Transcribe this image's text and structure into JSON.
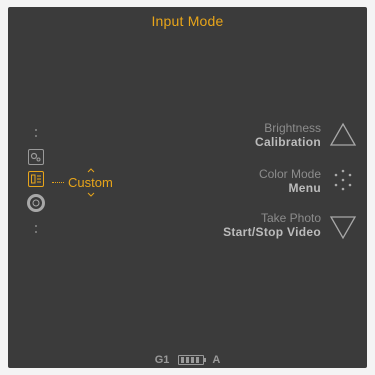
{
  "screen": {
    "title": "Input Mode"
  },
  "mode_selector": {
    "icons": [
      "photo-settings-icon",
      "custom-mode-icon",
      "shutter-icon"
    ],
    "selected_label": "Custom",
    "accent_color": "#e8a51a"
  },
  "controls": [
    {
      "line1": "Brightness",
      "line2": "Calibration",
      "icon": "triangle-up-icon"
    },
    {
      "line1": "Color Mode",
      "line2": "Menu",
      "icon": "dotted-circle-icon"
    },
    {
      "line1": "Take Photo",
      "line2": "Start/Stop Video",
      "icon": "triangle-down-icon"
    }
  ],
  "status_bar": {
    "profile": "G1",
    "battery_icon": "battery-icon",
    "mode": "A"
  }
}
